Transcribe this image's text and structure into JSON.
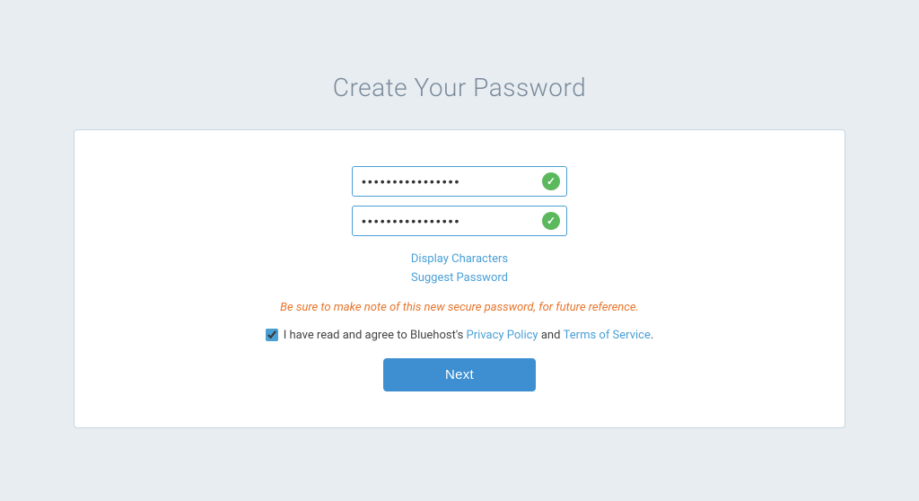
{
  "page": {
    "title": "Create Your Password",
    "background_color": "#e8edf2"
  },
  "card": {
    "border_color": "#c8d6e0"
  },
  "form": {
    "password_field_1": {
      "placeholder": "",
      "value": "••••••••••••••••",
      "type": "password"
    },
    "password_field_2": {
      "placeholder": "",
      "value": "••••••••••••••••",
      "type": "password"
    },
    "display_characters_label": "Display Characters",
    "suggest_password_label": "Suggest Password",
    "warning_text": "Be sure to make note of this new secure password, for future reference.",
    "terms_prefix": "I have read and agree to Bluehost's",
    "terms_privacy_label": "Privacy Policy",
    "terms_and": "and",
    "terms_of_service_label": "Terms of Service",
    "terms_suffix": ".",
    "checkbox_checked": true,
    "next_button_label": "Next"
  }
}
